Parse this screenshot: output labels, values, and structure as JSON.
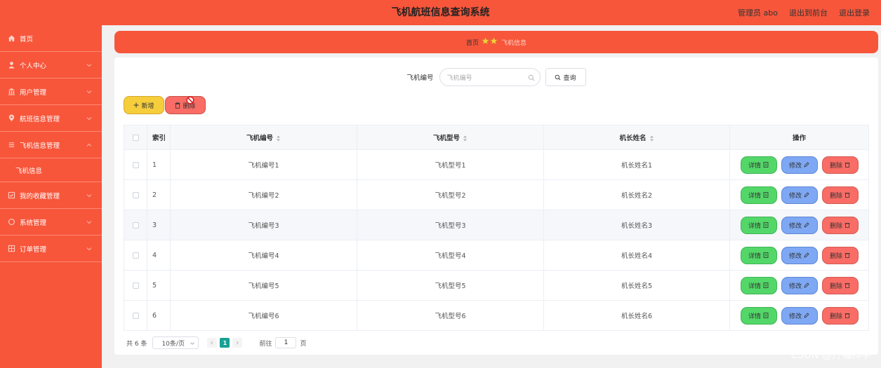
{
  "header": {
    "title": "飞机航班信息查询系统",
    "admin": "管理员 abo",
    "front": "退出到前台",
    "logout": "退出登录"
  },
  "sidebar": {
    "items": [
      {
        "label": "首页",
        "icon": "home-icon"
      },
      {
        "label": "个人中心",
        "icon": "user-icon"
      },
      {
        "label": "用户管理",
        "icon": "bank-icon"
      },
      {
        "label": "航班信息管理",
        "icon": "location-icon"
      },
      {
        "label": "飞机信息管理",
        "icon": "list-icon"
      },
      {
        "label": "飞机信息",
        "icon": ""
      },
      {
        "label": "我的收藏管理",
        "icon": "check-square-icon"
      },
      {
        "label": "系统管理",
        "icon": "circle-icon"
      },
      {
        "label": "订单管理",
        "icon": "grid-icon"
      }
    ]
  },
  "breadcrumb": {
    "home": "首页",
    "current": "飞机信息"
  },
  "search": {
    "label": "飞机编号",
    "placeholder": "飞机编号",
    "button": "查询"
  },
  "actions": {
    "add": "新增",
    "delete": "删除"
  },
  "table": {
    "headers": [
      "索引",
      "飞机编号",
      "飞机型号",
      "机长姓名",
      "操作"
    ],
    "rows": [
      {
        "index": "1",
        "code": "飞机编号1",
        "model": "飞机型号1",
        "captain": "机长姓名1"
      },
      {
        "index": "2",
        "code": "飞机编号2",
        "model": "飞机型号2",
        "captain": "机长姓名2"
      },
      {
        "index": "3",
        "code": "飞机编号3",
        "model": "飞机型号3",
        "captain": "机长姓名3"
      },
      {
        "index": "4",
        "code": "飞机编号4",
        "model": "飞机型号4",
        "captain": "机长姓名4"
      },
      {
        "index": "5",
        "code": "飞机编号5",
        "model": "飞机型号5",
        "captain": "机长姓名5"
      },
      {
        "index": "6",
        "code": "飞机编号6",
        "model": "飞机型号6",
        "captain": "机长姓名6"
      }
    ],
    "ops": {
      "detail": "详情",
      "edit": "修改",
      "remove": "删除"
    }
  },
  "pagination": {
    "total": "共 6 条",
    "page_size": "10条/页",
    "current_page": "1",
    "goto_label": "前往",
    "goto_value": "1",
    "page_suffix": "页"
  },
  "watermark": "CSDN @升幅科学",
  "colors": {
    "primary": "#f7563b",
    "add": "#f6ce3c",
    "delete": "#f96d66",
    "detail": "#53d769",
    "edit": "#7ea8f4",
    "pager_active": "#1aa094"
  }
}
